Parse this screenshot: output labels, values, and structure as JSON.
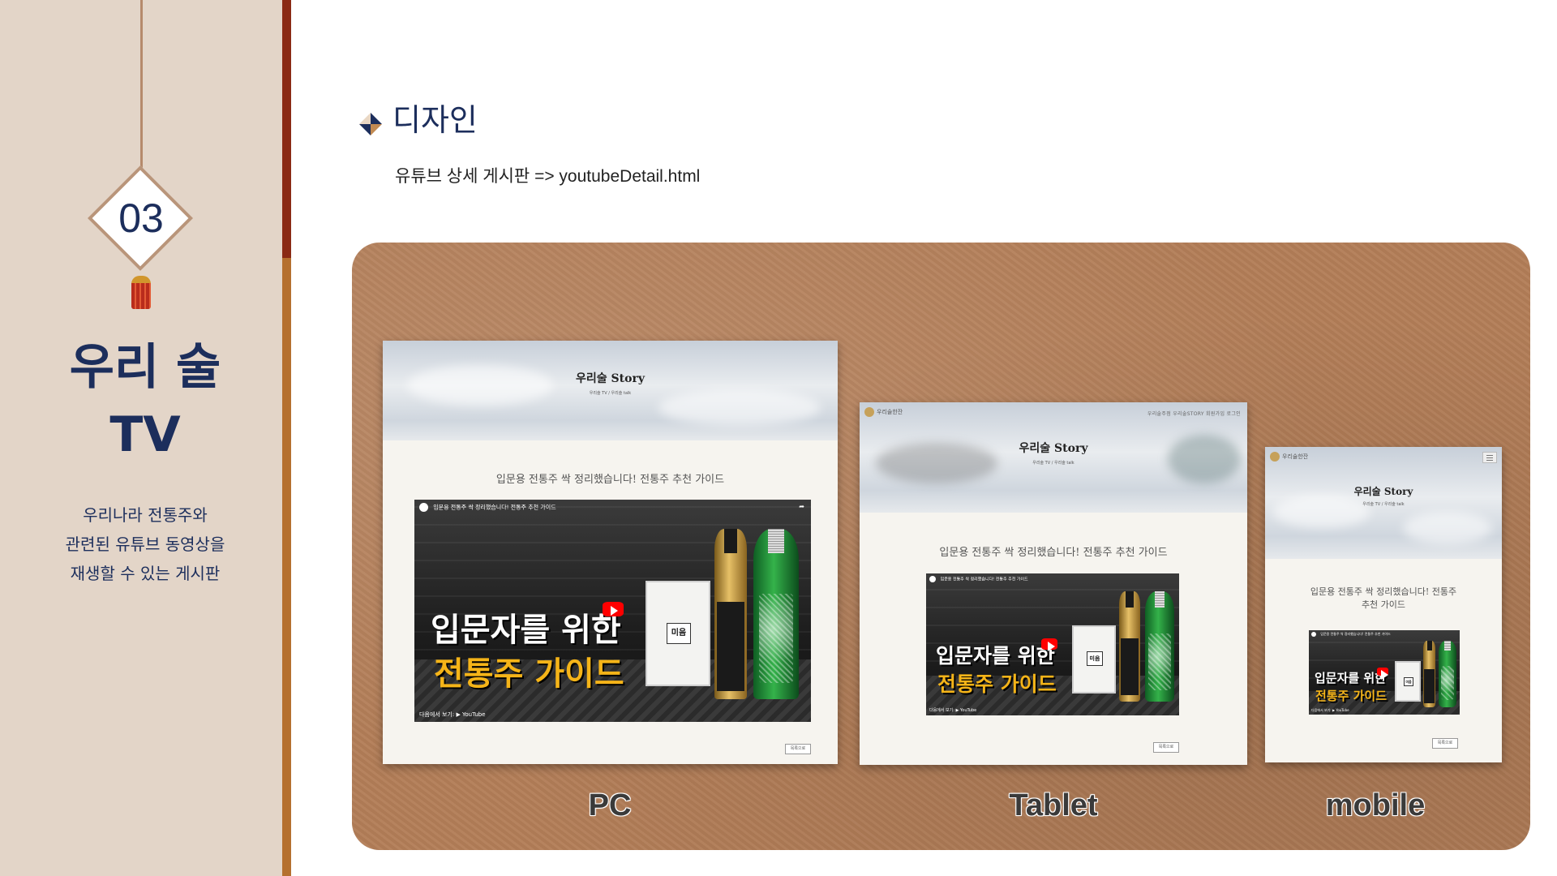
{
  "sidebar": {
    "section_number": "03",
    "title_line1": "우리 술",
    "title_line2": "TV",
    "description_line1": "우리나라 전통주와",
    "description_line2": "관련된 유튜브 동영상을",
    "description_line3": "재생할 수 있는 게시판"
  },
  "content": {
    "heading": "디자인",
    "subtext": "유튜브 상세 게시판 => youtubeDetail.html"
  },
  "site": {
    "title": "우리술 Story",
    "breadcrumb": "우리술 TV  /  우리술 talk",
    "logo_text": "우리술한잔",
    "nav_items": "우리술주점   우리술STORY   회원가입   로그인",
    "post_title": "입문용 전통주 싹 정리했습니다! 전통주 추천 가이드",
    "post_title_mobile_line1": "입문용 전통주 싹 정리했습니다! 전통주",
    "post_title_mobile_line2": "추천 가이드",
    "list_button": "목록으로"
  },
  "video": {
    "top_title": "입문용 전통주 싹 정리했습니다! 전통주 추천 가이드",
    "headline_line1": "입문자를 위한",
    "headline_line2": "전통주 가이드",
    "brand_mark": "미음",
    "watch_on": "다음에서 보기:  ▶ YouTube",
    "share_label": "공유"
  },
  "devices": {
    "pc_label": "PC",
    "tablet_label": "Tablet",
    "mobile_label": "mobile"
  },
  "colors": {
    "navy": "#1c2e5c",
    "board_brown": "#b37e58",
    "accent_red": "#8a2a15",
    "accent_orange": "#b5702f",
    "youtube_red": "#ff0000",
    "headline_yellow": "#f5b418"
  },
  "icons": {
    "heading_icon": "diamond-bullet-icon",
    "play_icon": "youtube-play-icon",
    "menu_icon": "hamburger-menu-icon"
  }
}
